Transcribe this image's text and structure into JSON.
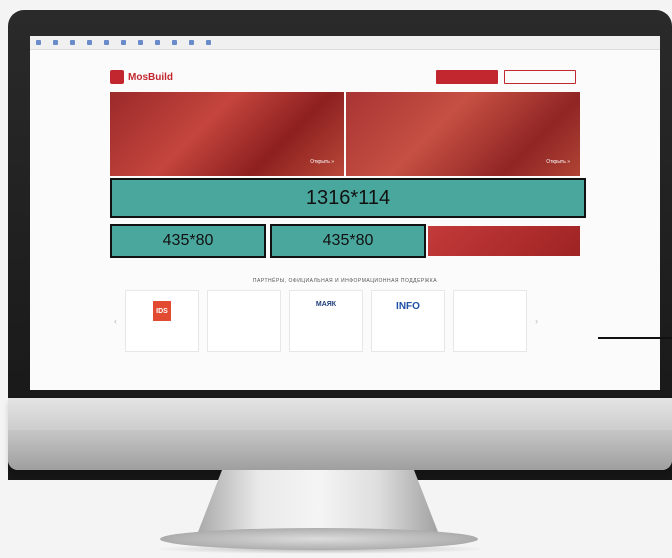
{
  "bookmarks": [
    "",
    "",
    "",
    "",
    "",
    "",
    "",
    "",
    "",
    "",
    ""
  ],
  "notice": {
    "left": "",
    "right": ""
  },
  "header": {
    "logo": "MosBuild",
    "nav": [
      "",
      "",
      "",
      "",
      ""
    ],
    "primary_button": "",
    "secondary_button": ""
  },
  "banners": {
    "left": {
      "text": "",
      "more": "Открыть »"
    },
    "right": {
      "text": "",
      "more": "Открыть »"
    }
  },
  "placeholders": {
    "big": "1316*114",
    "small_a": "435*80",
    "small_b": "435*80"
  },
  "promo": {
    "text": ""
  },
  "partners": {
    "title": "ПАРТНЁРЫ, ОФИЦИАЛЬНАЯ И ИНФОРМАЦИОННАЯ ПОДДЕРЖКА",
    "items": [
      {
        "caption": "",
        "logo": "IDS"
      },
      {
        "caption": "",
        "logo": ""
      },
      {
        "caption": "",
        "logo": "МАЯК"
      },
      {
        "caption": "",
        "logo": "INFO"
      },
      {
        "caption": "",
        "logo": ""
      }
    ]
  },
  "colors": {
    "brand_red": "#c2262e",
    "placeholder_teal": "#4aa79d"
  }
}
